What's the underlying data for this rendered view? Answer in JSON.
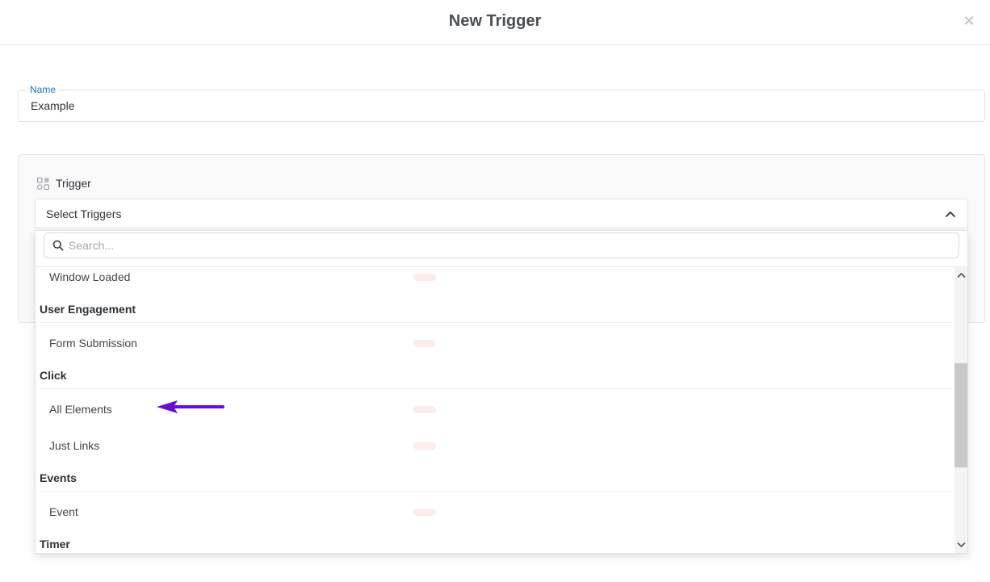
{
  "modal": {
    "title": "New Trigger",
    "close_icon": "close-icon"
  },
  "name_field": {
    "label": "Name",
    "value": "Example"
  },
  "trigger_panel": {
    "title": "Trigger",
    "icon": "grid-icon",
    "select": {
      "placeholder": "Select Triggers",
      "icon": "chevron-up-icon"
    },
    "dropdown": {
      "search_placeholder": "Search...",
      "items": [
        {
          "type": "option",
          "label": "Window Loaded"
        },
        {
          "type": "group",
          "label": "User Engagement"
        },
        {
          "type": "option",
          "label": "Form Submission"
        },
        {
          "type": "group",
          "label": "Click"
        },
        {
          "type": "option",
          "label": "All Elements"
        },
        {
          "type": "option",
          "label": "Just Links"
        },
        {
          "type": "group",
          "label": "Events"
        },
        {
          "type": "option",
          "label": "Event"
        },
        {
          "type": "group",
          "label": "Timer"
        }
      ]
    }
  },
  "colors": {
    "accent_label": "#1c6fd1",
    "annotation_arrow": "#6a0dcc",
    "badge": "#fdeceb",
    "scroll_thumb": "#c9c9c9"
  }
}
